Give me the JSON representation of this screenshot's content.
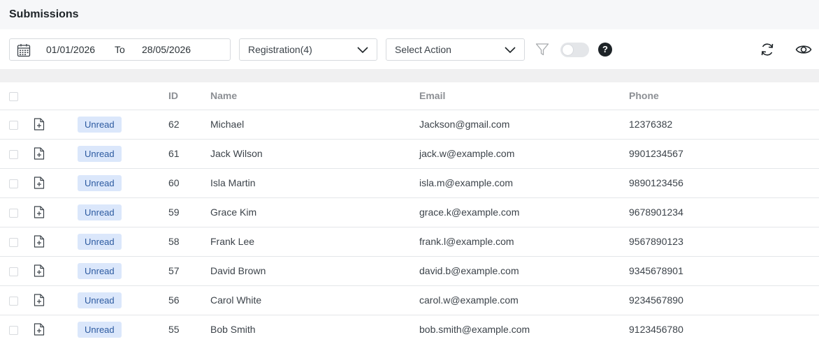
{
  "page": {
    "title": "Submissions"
  },
  "toolbar": {
    "date_from": "01/01/2026",
    "date_to_label": "To",
    "date_to": "28/05/2026",
    "form_select": "Registration(4)",
    "action_select": "Select Action",
    "help_label": "?"
  },
  "table": {
    "columns": [
      "ID",
      "Name",
      "Email",
      "Phone"
    ],
    "rows": [
      {
        "status": "Unread",
        "id": "62",
        "name": "Michael",
        "email": "Jackson@gmail.com",
        "phone": "12376382"
      },
      {
        "status": "Unread",
        "id": "61",
        "name": "Jack Wilson",
        "email": "jack.w@example.com",
        "phone": "9901234567"
      },
      {
        "status": "Unread",
        "id": "60",
        "name": "Isla Martin",
        "email": "isla.m@example.com",
        "phone": "9890123456"
      },
      {
        "status": "Unread",
        "id": "59",
        "name": "Grace Kim",
        "email": "grace.k@example.com",
        "phone": "9678901234"
      },
      {
        "status": "Unread",
        "id": "58",
        "name": "Frank Lee",
        "email": "frank.l@example.com",
        "phone": "9567890123"
      },
      {
        "status": "Unread",
        "id": "57",
        "name": "David Brown",
        "email": "david.b@example.com",
        "phone": "9345678901"
      },
      {
        "status": "Unread",
        "id": "56",
        "name": "Carol White",
        "email": "carol.w@example.com",
        "phone": "9234567890"
      },
      {
        "status": "Unread",
        "id": "55",
        "name": "Bob Smith",
        "email": "bob.smith@example.com",
        "phone": "9123456780"
      }
    ]
  },
  "colors": {
    "badge_bg": "#dbe7fb",
    "badge_text": "#2c5aa0",
    "header_bg": "#f6f7f9"
  }
}
